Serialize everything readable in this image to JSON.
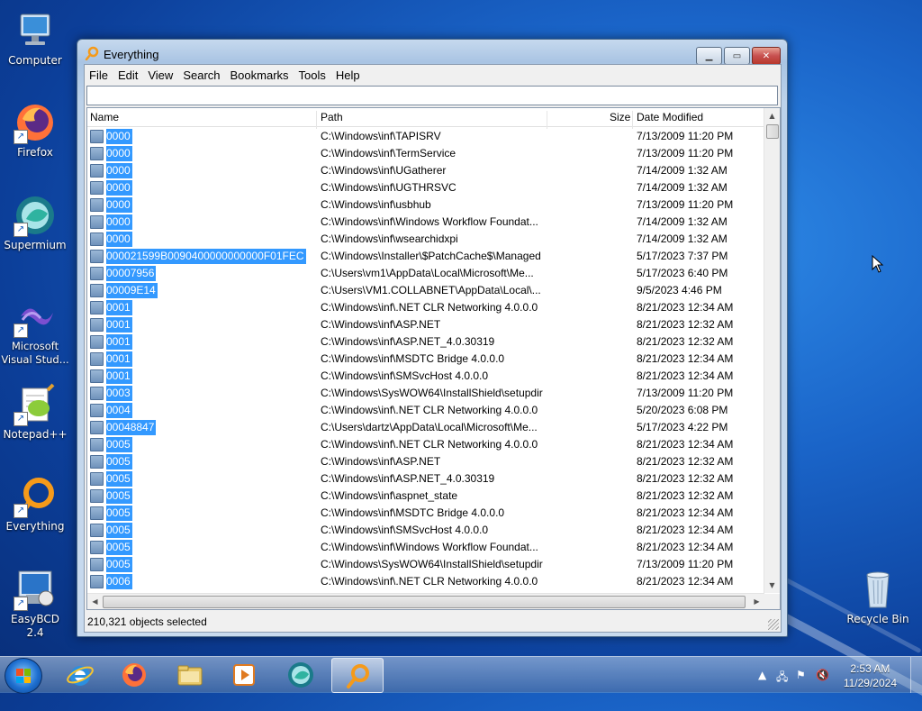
{
  "desktop": {
    "icons": [
      {
        "label": "Computer"
      },
      {
        "label": "Firefox"
      },
      {
        "label": "Supermium"
      },
      {
        "label": "Microsoft Visual Stud..."
      },
      {
        "label": "Notepad++"
      },
      {
        "label": "Everything"
      },
      {
        "label": "EasyBCD 2.4"
      },
      {
        "label": "Recycle Bin"
      }
    ]
  },
  "window": {
    "title": "Everything",
    "menu": [
      "File",
      "Edit",
      "View",
      "Search",
      "Bookmarks",
      "Tools",
      "Help"
    ],
    "search": {
      "value": "",
      "placeholder": ""
    },
    "columns": {
      "name": "Name",
      "path": "Path",
      "size": "Size",
      "date": "Date Modified"
    },
    "rows": [
      {
        "name": "0000",
        "path": "C:\\Windows\\inf\\TAPISRV",
        "date": "7/13/2009 11:20 PM"
      },
      {
        "name": "0000",
        "path": "C:\\Windows\\inf\\TermService",
        "date": "7/13/2009 11:20 PM"
      },
      {
        "name": "0000",
        "path": "C:\\Windows\\inf\\UGatherer",
        "date": "7/14/2009 1:32 AM"
      },
      {
        "name": "0000",
        "path": "C:\\Windows\\inf\\UGTHRSVC",
        "date": "7/14/2009 1:32 AM"
      },
      {
        "name": "0000",
        "path": "C:\\Windows\\inf\\usbhub",
        "date": "7/13/2009 11:20 PM"
      },
      {
        "name": "0000",
        "path": "C:\\Windows\\inf\\Windows Workflow Foundat...",
        "date": "7/14/2009 1:32 AM"
      },
      {
        "name": "0000",
        "path": "C:\\Windows\\inf\\wsearchidxpi",
        "date": "7/14/2009 1:32 AM"
      },
      {
        "name": "000021599B0090400000000000F01FEC",
        "path": "C:\\Windows\\Installer\\$PatchCache$\\Managed",
        "date": "5/17/2023 7:37 PM"
      },
      {
        "name": "00007956",
        "path": "C:\\Users\\vm1\\AppData\\Local\\Microsoft\\Me...",
        "date": "5/17/2023 6:40 PM"
      },
      {
        "name": "00009E14",
        "path": "C:\\Users\\VM1.COLLABNET\\AppData\\Local\\...",
        "date": "9/5/2023 4:46 PM"
      },
      {
        "name": "0001",
        "path": "C:\\Windows\\inf\\.NET CLR Networking 4.0.0.0",
        "date": "8/21/2023 12:34 AM"
      },
      {
        "name": "0001",
        "path": "C:\\Windows\\inf\\ASP.NET",
        "date": "8/21/2023 12:32 AM"
      },
      {
        "name": "0001",
        "path": "C:\\Windows\\inf\\ASP.NET_4.0.30319",
        "date": "8/21/2023 12:32 AM"
      },
      {
        "name": "0001",
        "path": "C:\\Windows\\inf\\MSDTC Bridge 4.0.0.0",
        "date": "8/21/2023 12:34 AM"
      },
      {
        "name": "0001",
        "path": "C:\\Windows\\inf\\SMSvcHost 4.0.0.0",
        "date": "8/21/2023 12:34 AM"
      },
      {
        "name": "0003",
        "path": "C:\\Windows\\SysWOW64\\InstallShield\\setupdir",
        "date": "7/13/2009 11:20 PM"
      },
      {
        "name": "0004",
        "path": "C:\\Windows\\inf\\.NET CLR Networking 4.0.0.0",
        "date": "5/20/2023 6:08 PM"
      },
      {
        "name": "00048847",
        "path": "C:\\Users\\dartz\\AppData\\Local\\Microsoft\\Me...",
        "date": "5/17/2023 4:22 PM"
      },
      {
        "name": "0005",
        "path": "C:\\Windows\\inf\\.NET CLR Networking 4.0.0.0",
        "date": "8/21/2023 12:34 AM"
      },
      {
        "name": "0005",
        "path": "C:\\Windows\\inf\\ASP.NET",
        "date": "8/21/2023 12:32 AM"
      },
      {
        "name": "0005",
        "path": "C:\\Windows\\inf\\ASP.NET_4.0.30319",
        "date": "8/21/2023 12:32 AM"
      },
      {
        "name": "0005",
        "path": "C:\\Windows\\inf\\aspnet_state",
        "date": "8/21/2023 12:32 AM"
      },
      {
        "name": "0005",
        "path": "C:\\Windows\\inf\\MSDTC Bridge 4.0.0.0",
        "date": "8/21/2023 12:34 AM"
      },
      {
        "name": "0005",
        "path": "C:\\Windows\\inf\\SMSvcHost 4.0.0.0",
        "date": "8/21/2023 12:34 AM"
      },
      {
        "name": "0005",
        "path": "C:\\Windows\\inf\\Windows Workflow Foundat...",
        "date": "8/21/2023 12:34 AM"
      },
      {
        "name": "0005",
        "path": "C:\\Windows\\SysWOW64\\InstallShield\\setupdir",
        "date": "7/13/2009 11:20 PM"
      },
      {
        "name": "0006",
        "path": "C:\\Windows\\inf\\.NET CLR Networking 4.0.0.0",
        "date": "8/21/2023 12:34 AM"
      }
    ],
    "status": "210,321 objects selected"
  },
  "taskbar": {
    "apps": [
      "internet-explorer",
      "firefox",
      "file-explorer",
      "media-player",
      "supermium",
      "everything"
    ],
    "clock": {
      "time": "2:53 AM",
      "date": "11/29/2024"
    }
  },
  "colors": {
    "selection": "#3399ff",
    "accent_orange": "#f5a020"
  }
}
